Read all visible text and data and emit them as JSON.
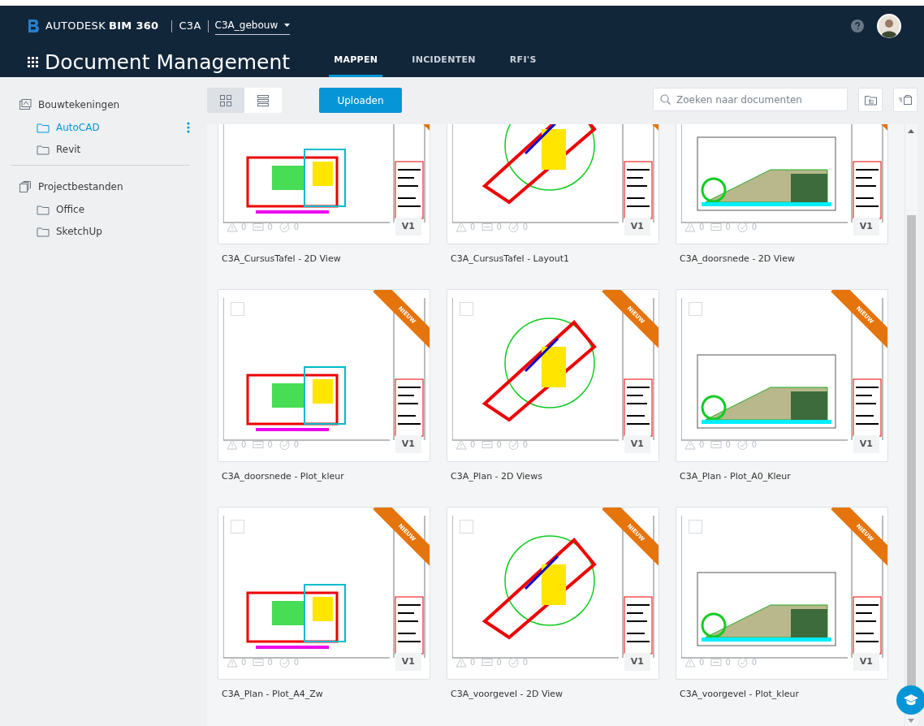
{
  "header": {
    "brand": "AUTODESK",
    "product": "BIM 360",
    "account": "C3A",
    "project": "C3A_gebouw",
    "app_title": "Document Management"
  },
  "tabs": [
    {
      "label": "MAPPEN",
      "selected": true
    },
    {
      "label": "INCIDENTEN",
      "selected": false
    },
    {
      "label": "RFI'S",
      "selected": false
    }
  ],
  "sidebar": {
    "sections": [
      {
        "label": "Bouwtekeningen",
        "kind": "drawings",
        "children": [
          {
            "label": "AutoCAD",
            "selected": true
          },
          {
            "label": "Revit",
            "selected": false
          }
        ]
      },
      {
        "label": "Projectbestanden",
        "kind": "files",
        "children": [
          {
            "label": "Office",
            "selected": false
          },
          {
            "label": "SketchUp",
            "selected": false
          }
        ]
      }
    ]
  },
  "toolbar": {
    "view_modes": [
      {
        "kind": "grid",
        "selected": true
      },
      {
        "kind": "list",
        "selected": false
      }
    ],
    "upload": "Uploaden",
    "search": {
      "placeholder": "Zoeken naar documenten"
    }
  },
  "documents": [
    {
      "name": "C3A_CursusTafel - 2D View",
      "version": "V1",
      "issues": "0",
      "rfis": "0",
      "reviews": "0",
      "new": true
    },
    {
      "name": "C3A_CursusTafel - Layout1",
      "version": "V1",
      "issues": "0",
      "rfis": "0",
      "reviews": "0",
      "new": true
    },
    {
      "name": "C3A_doorsnede - 2D View",
      "version": "V1",
      "issues": "0",
      "rfis": "0",
      "reviews": "0",
      "new": true
    },
    {
      "name": "C3A_doorsnede - Plot_kleur",
      "version": "V1",
      "issues": "0",
      "rfis": "0",
      "reviews": "0",
      "new": true,
      "badge": "NIEUW",
      "checked": false
    },
    {
      "name": "C3A_Plan - 2D Views",
      "version": "V1",
      "issues": "0",
      "rfis": "0",
      "reviews": "0",
      "new": true,
      "badge": "NIEUW",
      "checked": false
    },
    {
      "name": "C3A_Plan - Plot_A0_Kleur",
      "version": "V1",
      "issues": "0",
      "rfis": "0",
      "reviews": "0",
      "new": true,
      "badge": "NIEUW",
      "checked": false
    },
    {
      "name": "C3A_Plan - Plot_A4_Zw",
      "version": "V1",
      "issues": "0",
      "rfis": "0",
      "reviews": "0",
      "new": true,
      "badge": "NIEUW",
      "checked": false
    },
    {
      "name": "C3A_voorgevel - 2D View",
      "version": "V1",
      "issues": "0",
      "rfis": "0",
      "reviews": "0",
      "new": true,
      "badge": "NIEUW",
      "checked": false
    },
    {
      "name": "C3A_voorgevel - Plot_kleur",
      "version": "V1",
      "issues": "0",
      "rfis": "0",
      "reviews": "0",
      "new": true,
      "badge": "NIEUW",
      "checked": false
    }
  ]
}
